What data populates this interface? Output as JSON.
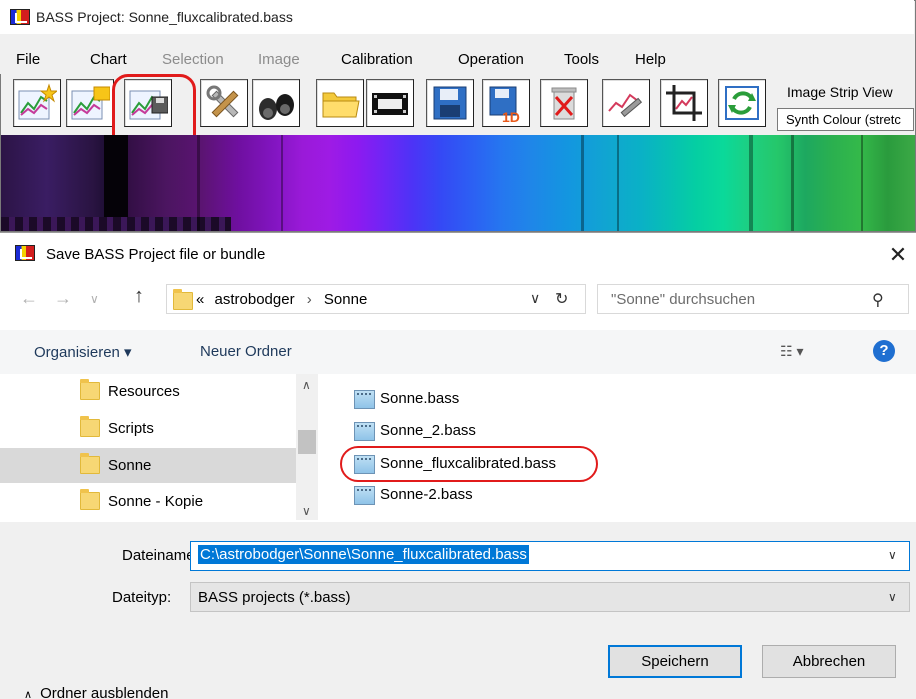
{
  "bass": {
    "title": "BASS Project: Sonne_fluxcalibrated.bass",
    "menu": [
      "File",
      "Chart",
      "Selection",
      "Image",
      "Calibration",
      "Operation",
      "Tools",
      "Help"
    ],
    "menu_disabled": [
      "Selection",
      "Image"
    ],
    "toolbar_icons": [
      "new-chart-icon",
      "open-chart-icon",
      "save-chart-icon",
      "settings-tools-icon",
      "binoculars-icon",
      "open-folder-icon",
      "filmstrip-icon",
      "save-disk-icon",
      "save-1d-icon",
      "delete-trash-icon",
      "calibration-icon",
      "crop-icon",
      "refresh-icon"
    ],
    "toolbar_1d_label": "1D",
    "strip_view": {
      "label": "Image Strip View",
      "selected": "Synth Colour (stretc"
    }
  },
  "dialog": {
    "title": "Save BASS Project file or bundle",
    "close_label": "✕",
    "address": {
      "prefix": "«",
      "path": [
        "astrobodger",
        "Sonne"
      ],
      "separator": "›"
    },
    "search_placeholder": "\"Sonne\" durchsuchen",
    "organize_label": "Organisieren ▾",
    "new_folder_label": "Neuer Ordner",
    "help_label": "?",
    "nav_items": [
      {
        "label": "Resources"
      },
      {
        "label": "Scripts"
      },
      {
        "label": "Sonne",
        "selected": true
      },
      {
        "label": "Sonne - Kopie"
      }
    ],
    "files": [
      {
        "label": "Sonne.bass"
      },
      {
        "label": "Sonne_2.bass"
      },
      {
        "label": "Sonne_fluxcalibrated.bass",
        "highlighted": true
      },
      {
        "label": "Sonne-2.bass"
      }
    ],
    "filename_label": "Dateiname:",
    "filename_value": "C:\\astrobodger\\Sonne\\Sonne_fluxcalibrated.bass",
    "filetype_label": "Dateityp:",
    "filetype_value": "BASS projects (*.bass)",
    "hide_folders_label": "Ordner ausblenden",
    "save_label": "Speichern",
    "cancel_label": "Abbrechen"
  },
  "colors": {
    "highlight_red": "#e11b1b",
    "selection_blue": "#0078d7",
    "link_blue": "#1e395b"
  }
}
